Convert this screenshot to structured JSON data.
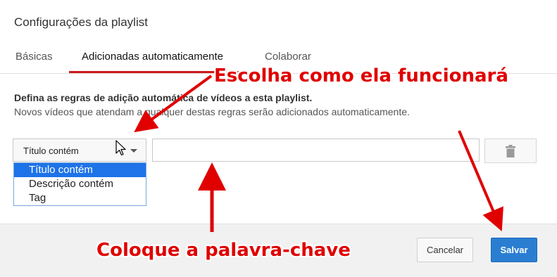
{
  "dialog": {
    "title": "Configurações da playlist"
  },
  "tabs": [
    {
      "label": "Básicas",
      "active": false
    },
    {
      "label": "Adicionadas automaticamente",
      "active": true
    },
    {
      "label": "Colaborar",
      "active": false
    }
  ],
  "description": {
    "line1": "Defina as regras de adição automática de vídeos a esta playlist.",
    "line2": "Novos vídeos que atendam a qualquer destas regras serão adicionados automaticamente."
  },
  "rule": {
    "selected": "Título contém",
    "options": [
      "Título contém",
      "Descrição contém",
      "Tag"
    ],
    "keyword_value": ""
  },
  "footer": {
    "cancel_label": "Cancelar",
    "save_label": "Salvar"
  },
  "annotations": {
    "top": "Escolha como ela funcionará",
    "bottom": "Coloque a palavra-chave",
    "color": "#e00000"
  },
  "colors": {
    "tab_underline": "#cc181e",
    "save_button": "#2a7ed2",
    "option_highlight": "#1e73e8"
  },
  "icons": {
    "trash": "trash-icon",
    "caret": "caret-down-icon",
    "cursor": "mouse-pointer-icon"
  }
}
